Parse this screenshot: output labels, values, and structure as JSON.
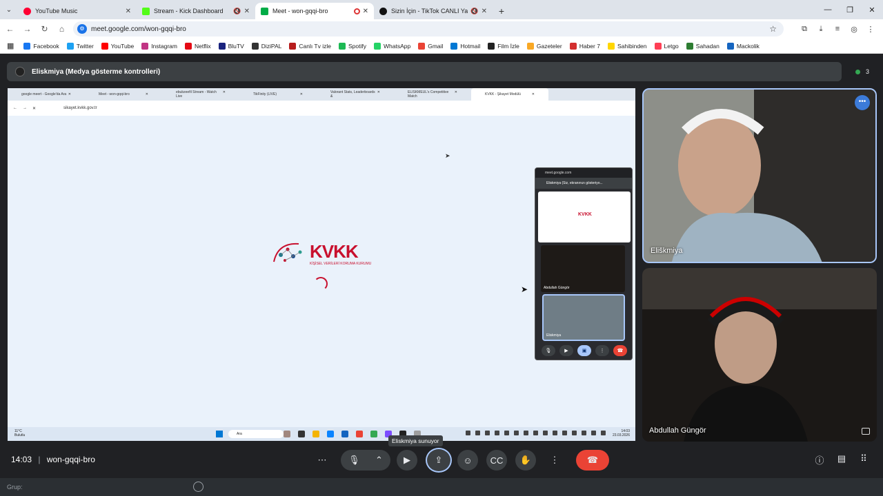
{
  "tabs": [
    {
      "label": "YouTube Music",
      "color": "#ff0033"
    },
    {
      "label": "Stream - Kick Dashboard",
      "color": "#53fc18"
    },
    {
      "label": "Meet - won-gqqi-bro",
      "color": "#00ac47",
      "active": true
    },
    {
      "label": "Sizin İçin - TikTok CANLI Yay",
      "color": "#111111"
    }
  ],
  "address": {
    "url": "meet.google.com/won-gqqi-bro"
  },
  "bookmarks": [
    {
      "label": "Facebook",
      "color": "#1877f2"
    },
    {
      "label": "Twitter",
      "color": "#1da1f2"
    },
    {
      "label": "YouTube",
      "color": "#ff0000"
    },
    {
      "label": "Instagram",
      "color": "#c13584"
    },
    {
      "label": "Netflix",
      "color": "#e50914"
    },
    {
      "label": "BluTV",
      "color": "#1a237e"
    },
    {
      "label": "DiziPAL",
      "color": "#333333"
    },
    {
      "label": "Canlı Tv izle",
      "color": "#b71c1c"
    },
    {
      "label": "Spotify",
      "color": "#1db954"
    },
    {
      "label": "WhatsApp",
      "color": "#25d366"
    },
    {
      "label": "Gmail",
      "color": "#ea4335"
    },
    {
      "label": "Hotmail",
      "color": "#0078d4"
    },
    {
      "label": "Film İzle",
      "color": "#222222"
    },
    {
      "label": "Gazeteler",
      "color": "#f9a825"
    },
    {
      "label": "Haber 7",
      "color": "#d32f2f"
    },
    {
      "label": "Sahibinden",
      "color": "#ffd600"
    },
    {
      "label": "Letgo",
      "color": "#ff3f55"
    },
    {
      "label": "Sahadan",
      "color": "#2e7d32"
    },
    {
      "label": "Mackolik",
      "color": "#1565c0"
    }
  ],
  "meet": {
    "presenter_bar": "Eliskmiya (Medya gösterme kontrolleri)",
    "participant_count": "3",
    "shared": {
      "tabs": [
        "google meert - Google'da Ara",
        "Meet - won-gqqi-bro",
        "ebubzeefil Stream - Watch Live",
        "TikFinity (LIVE)",
        "Valorant Stats, Leaderboards &",
        "ELISKMEUL's Competitive Match",
        "KVKK - Şikayet Modülü"
      ],
      "url": "sikayet.kvkk.gov.tr",
      "logo_text": "KVKK",
      "logo_sub": "KİŞİSEL VERİLERİ KORUMA KURUMU",
      "pip_header": "meet.google.com",
      "pip_title": "Eliskmiya (Siz, ekranınızı gösteriyo...",
      "pip_name1": "Abdullah Güngör",
      "pip_name2": "Eliskmiya",
      "weather": "11°C",
      "weather_sub": "Bulutlu",
      "search": "Ara",
      "time": "14:03",
      "date": "23.03.2026"
    },
    "tiles": [
      {
        "name": "Eliškmiya"
      },
      {
        "name": "Abdullah Güngör"
      }
    ],
    "tooltip": "Eliskmiya sunuyor",
    "clock": "14:03",
    "meeting_code": "won-gqqi-bro",
    "chat_placeholder": "Grup:"
  }
}
